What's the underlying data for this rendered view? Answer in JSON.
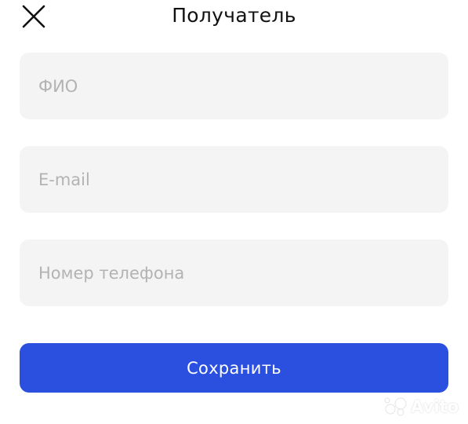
{
  "header": {
    "title": "Получатель",
    "close_icon": "close-icon"
  },
  "form": {
    "name_placeholder": "ФИО",
    "name_value": "",
    "email_placeholder": "E-mail",
    "email_value": "",
    "phone_placeholder": "Номер телефона",
    "phone_value": ""
  },
  "actions": {
    "save_label": "Сохранить"
  },
  "watermark": {
    "text": "Avito"
  },
  "colors": {
    "primary": "#2b50e0",
    "field_bg": "#f4f4f4",
    "placeholder": "#b3b3b3",
    "text": "#111111"
  }
}
